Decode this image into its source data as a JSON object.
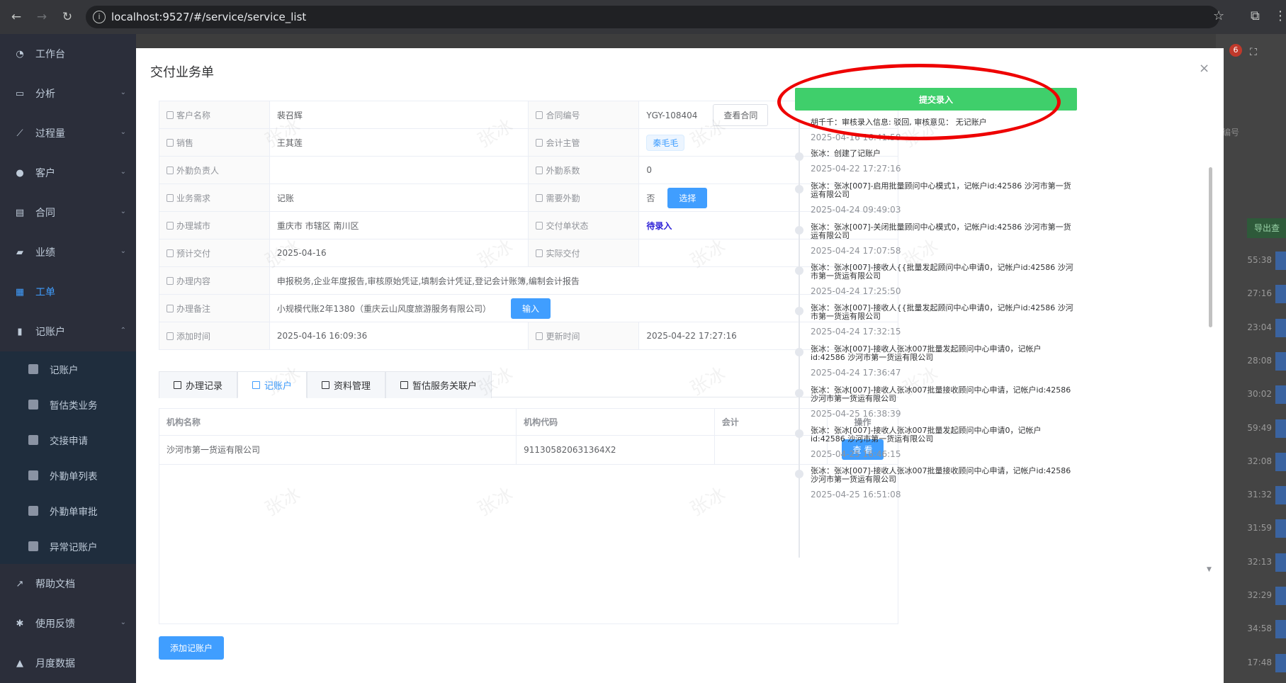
{
  "browser": {
    "url": "localhost:9527/#/service/service_list"
  },
  "sidebar": {
    "items": [
      {
        "label": "工作台",
        "icon": "dashboard-icon"
      },
      {
        "label": "分析",
        "icon": "monitor-icon",
        "has_arrow": true
      },
      {
        "label": "过程量",
        "icon": "chart-icon",
        "has_arrow": true
      },
      {
        "label": "客户",
        "icon": "user-icon",
        "has_arrow": true
      },
      {
        "label": "合同",
        "icon": "document-icon",
        "has_arrow": true
      },
      {
        "label": "业绩",
        "icon": "briefcase-icon",
        "has_arrow": true
      },
      {
        "label": "工单",
        "icon": "clipboard-icon",
        "active": true
      },
      {
        "label": "记账户",
        "icon": "book-icon",
        "expanded": true
      }
    ],
    "sub_items": [
      "记账户",
      "暂估类业务",
      "交接申请",
      "外勤单列表",
      "外勤单审批",
      "异常记账户"
    ],
    "bottom_items": [
      {
        "label": "帮助文档",
        "icon": "external-link-icon"
      },
      {
        "label": "使用反馈",
        "icon": "bug-icon",
        "has_arrow": true
      },
      {
        "label": "月度数据",
        "icon": "bar-chart-icon"
      }
    ]
  },
  "background": {
    "badge": "6",
    "export_button": "导出查",
    "times": [
      "55:38",
      "27:16",
      "23:04",
      "28:08",
      "30:02",
      "59:49",
      "32:08",
      "31:32",
      "31:59",
      "32:13",
      "32:29",
      "34:58",
      "17:48"
    ],
    "header_text": "编号"
  },
  "dialog": {
    "title": "交付业务单",
    "rows": [
      {
        "l1": "客户名称",
        "v1": "裴召辉",
        "l2": "合同编号",
        "v2": "YGY-108404",
        "btn2": "查看合同"
      },
      {
        "l1": "销售",
        "v1": "王其莲",
        "l2": "会计主管",
        "tag2": "秦毛毛"
      },
      {
        "l1": "外勤负责人",
        "v1": "",
        "l2": "外勤系数",
        "v2": "0"
      },
      {
        "l1": "业务需求",
        "v1": "记账",
        "l2": "需要外勤",
        "v2": "否",
        "btn2": "选择"
      },
      {
        "l1": "办理城市",
        "v1": "重庆市 市辖区 南川区",
        "l2": "交付单状态",
        "status2": "待录入"
      },
      {
        "l1": "预计交付",
        "v1": "2025-04-16",
        "l2": "实际交付",
        "v2": ""
      },
      {
        "l1": "办理内容",
        "v1": "申报税务,企业年度报告,审核原始凭证,填制会计凭证,登记会计账簿,编制会计报告"
      },
      {
        "l1": "办理备注",
        "v1": "小规模代账2年1380（重庆云山风度旅游服务有限公司）",
        "btn1": "输入"
      },
      {
        "l1": "添加时间",
        "v1": "2025-04-16 16:09:36",
        "l2": "更新时间",
        "v2": "2025-04-22 17:27:16"
      }
    ],
    "tabs": [
      "办理记录",
      "记账户",
      "资料管理",
      "暂估服务关联户"
    ],
    "active_tab": 1,
    "table": {
      "headers": [
        "机构名称",
        "机构代码",
        "会计",
        "操作"
      ],
      "rows": [
        {
          "name": "沙河市第一货运有限公司",
          "code": "911305820631364X2",
          "accountant": "",
          "action": "查 看"
        }
      ]
    },
    "add_button": "添加记账户",
    "watermark": "张冰"
  },
  "timeline": {
    "submit_button": "提交录入",
    "entries": [
      {
        "text": "胡千千：审核录入信息: 驳回, 审核意见： 无记账户",
        "time": "2025-04-16 16:41:58"
      },
      {
        "text": "张冰：创建了记账户",
        "time": "2025-04-22 17:27:16"
      },
      {
        "text": "张冰：张冰[007]-启用批量顾问中心模式1，记帐户id:42586 沙河市第一货运有限公司",
        "time": "2025-04-24 09:49:03"
      },
      {
        "text": "张冰：张冰[007]-关闭批量顾问中心模式0，记帐户id:42586 沙河市第一货运有限公司",
        "time": "2025-04-24 17:07:58"
      },
      {
        "text": "张冰：张冰[007]-接收人{{批量发起顾问中心申请0，记帐户id:42586 沙河市第一货运有限公司",
        "time": "2025-04-24 17:25:50"
      },
      {
        "text": "张冰：张冰[007]-接收人{{批量发起顾问中心申请0，记帐户id:42586 沙河市第一货运有限公司",
        "time": "2025-04-24 17:32:15"
      },
      {
        "text": "张冰：张冰[007]-接收人张冰007批量发起顾问中心申请0，记帐户id:42586 沙河市第一货运有限公司",
        "time": "2025-04-24 17:36:47"
      },
      {
        "text": "张冰：张冰[007]-接收人张冰007批量接收顾问中心申请，记帐户id:42586 沙河市第一货运有限公司",
        "time": "2025-04-25 16:38:39"
      },
      {
        "text": "张冰：张冰[007]-接收人张冰007批量发起顾问中心申请0，记帐户id:42586 沙河市第一货运有限公司",
        "time": "2025-04-25 16:46:15"
      },
      {
        "text": "张冰：张冰[007]-接收人张冰007批量接收顾问中心申请，记帐户id:42586 沙河市第一货运有限公司",
        "time": "2025-04-25 16:51:08"
      }
    ]
  },
  "colors": {
    "sidebar_bg": "#2b2e3a",
    "primary": "#409eff",
    "submit_green": "#3fcf6b",
    "highlight_red": "#ee0000"
  }
}
